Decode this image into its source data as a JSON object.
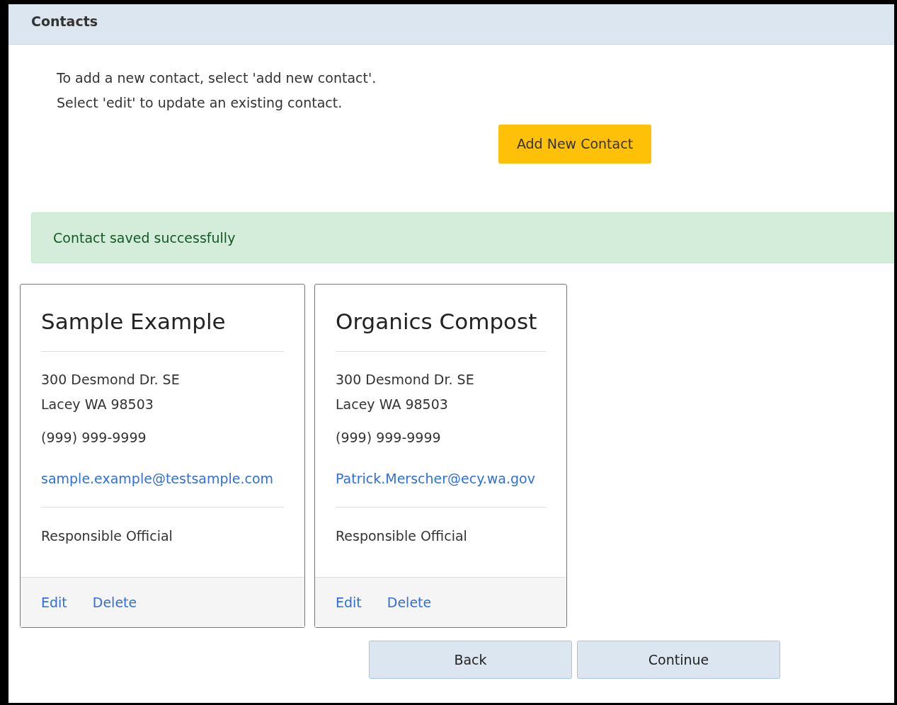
{
  "header": {
    "title": "Contacts"
  },
  "instructions": [
    "To add a new contact, select 'add new contact'.",
    "Select 'edit' to update an existing contact."
  ],
  "add_button": "Add New Contact",
  "alert": "Contact saved successfully",
  "contacts": [
    {
      "name": "Sample Example",
      "address_lines": [
        "300 Desmond Dr. SE",
        "Lacey WA 98503"
      ],
      "phone": "(999) 999-9999",
      "email": "sample.example@testsample.com",
      "role": "Responsible Official",
      "actions": [
        "Edit",
        "Delete"
      ]
    },
    {
      "name": "Organics Compost",
      "address_lines": [
        "300 Desmond Dr. SE",
        "Lacey WA 98503"
      ],
      "phone": "(999) 999-9999",
      "email": "Patrick.Merscher@ecy.wa.gov",
      "role": "Responsible Official",
      "actions": [
        "Edit",
        "Delete"
      ]
    }
  ],
  "nav_buttons": [
    "Back",
    "Continue"
  ]
}
